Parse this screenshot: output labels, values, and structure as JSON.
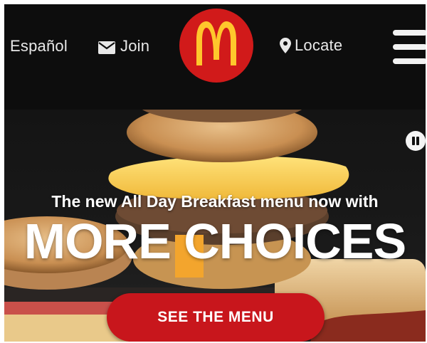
{
  "header": {
    "language_label": "Español",
    "join_label": "Join",
    "locate_label": "Locate",
    "icons": {
      "join": "envelope-icon",
      "locate": "map-pin-icon",
      "menu": "hamburger-menu-icon",
      "logo": "golden-arches-logo"
    },
    "colors": {
      "background": "#0d0d0d",
      "logo_red": "#d11a1a",
      "logo_gold": "#ffc72c"
    }
  },
  "hero": {
    "tagline": "The new All Day Breakfast menu now with",
    "headline": "MORE CHOICES",
    "cta_label": "SEE THE MENU",
    "pause_icon": "pause-icon",
    "colors": {
      "cta": "#c8161c",
      "text": "#ffffff"
    }
  }
}
